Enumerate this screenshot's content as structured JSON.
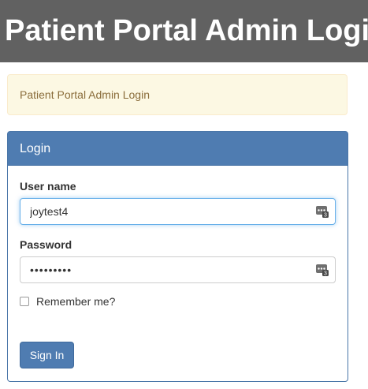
{
  "header": {
    "title": "Patient Portal Admin Login"
  },
  "notice": {
    "text": "Patient Portal Admin Login"
  },
  "login_panel": {
    "heading": "Login",
    "username": {
      "label": "User name",
      "value": "joytest4"
    },
    "password": {
      "label": "Password",
      "value": "•••••••••"
    },
    "remember": {
      "label": "Remember me?",
      "checked": false
    },
    "signin_label": "Sign In"
  },
  "icons": {
    "autofill": "password-manager-key-icon"
  },
  "colors": {
    "header_bg": "#616161",
    "notice_bg": "#fcf8e3",
    "panel_primary": "#4f7cb1"
  }
}
